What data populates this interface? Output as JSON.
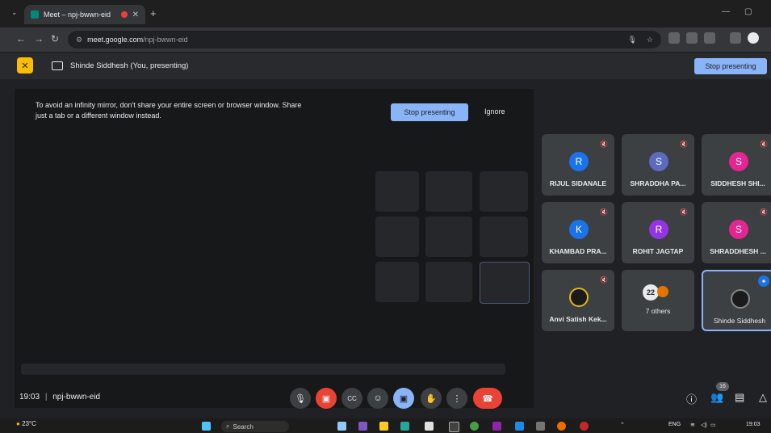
{
  "browser": {
    "tab_title": "Meet – npj-bwwn-eid",
    "url_host": "meet.google.com",
    "url_path": "/npj-bwwn-eid"
  },
  "presenting_bar": {
    "label": "Shinde Siddhesh (You, presenting)",
    "stop_label": "Stop presenting"
  },
  "warning": {
    "text_line1": "To avoid an infinity mirror, don't share your entire screen or browser window. Share",
    "text_line2": "just a tab or a different window instead.",
    "stop_label": "Stop presenting",
    "ignore_label": "Ignore"
  },
  "participants": [
    {
      "initial": "R",
      "name": "RIJUL SIDANALE",
      "color": "#1a73e8"
    },
    {
      "initial": "S",
      "name": "SHRADDHA PA...",
      "color": "#5c6bc0"
    },
    {
      "initial": "S",
      "name": "SIDDHESH SHI...",
      "color": "#e52592"
    },
    {
      "initial": "K",
      "name": "KHAMBAD PRA...",
      "color": "#1a73e8"
    },
    {
      "initial": "R",
      "name": "ROHIT JAGTAP",
      "color": "#9334e6"
    },
    {
      "initial": "S",
      "name": "SHRADDHESH ...",
      "color": "#e52592"
    },
    {
      "initial": "",
      "name": "Anvi Satish Kek...",
      "color": "#3c4043"
    },
    {
      "initial": "22",
      "name": "7 others",
      "color": "#3c4043"
    },
    {
      "initial": "",
      "name": "Shinde Siddhesh",
      "color": "#3c4043"
    }
  ],
  "meeting": {
    "time": "19:03",
    "code": "npj-bwwn-eid",
    "participants_count": "16"
  },
  "taskbar": {
    "weather_temp": "23°C",
    "search_label": "Search",
    "lang": "ENG",
    "time": "19:03"
  }
}
